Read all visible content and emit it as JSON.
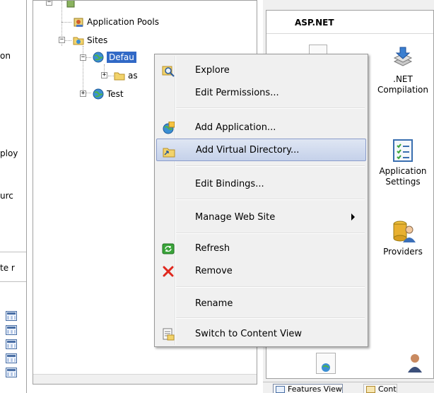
{
  "left_strip": {
    "fragments": [
      "on",
      "ploy",
      "urc",
      "te r"
    ]
  },
  "tree": {
    "top_item_partial": "...",
    "items": [
      {
        "label": "Application Pools",
        "icon": "app-pool-icon"
      },
      {
        "label": "Sites",
        "icon": "sites-folder-icon"
      },
      {
        "label": "Defau",
        "icon": "globe-icon",
        "selected": true
      },
      {
        "label": "as",
        "icon": "folder-icon"
      },
      {
        "label": "Test",
        "icon": "globe-icon"
      }
    ]
  },
  "features": {
    "group_title": "ASP.NET",
    "items": [
      {
        "label_line1": ".NET",
        "label_line2": "Compilation",
        "icon": "net-compilation-icon"
      },
      {
        "label_line1": "Application",
        "label_line2": "Settings",
        "icon": "app-settings-icon"
      },
      {
        "label_line1": "Providers",
        "label_line2": "",
        "icon": "providers-icon"
      }
    ]
  },
  "bottom_tabs": {
    "features_view": "Features View",
    "content_view": "Cont"
  },
  "context_menu": {
    "items": [
      {
        "label": "Explore",
        "icon": "explore-icon"
      },
      {
        "label": "Edit Permissions...",
        "icon": ""
      },
      {
        "label": "Add Application...",
        "icon": "add-application-icon"
      },
      {
        "label": "Add Virtual Directory...",
        "icon": "add-virtual-directory-icon",
        "highlighted": true
      },
      {
        "label": "Edit Bindings...",
        "icon": ""
      },
      {
        "label": "Manage Web Site",
        "icon": "",
        "submenu": true
      },
      {
        "label": "Refresh",
        "icon": "refresh-icon"
      },
      {
        "label": "Remove",
        "icon": "remove-icon"
      },
      {
        "label": "Rename",
        "icon": ""
      },
      {
        "label": "Switch to Content View",
        "icon": "content-view-icon"
      }
    ]
  },
  "colors": {
    "selection_blue": "#3169c6",
    "menu_highlight": "#c5d1ea",
    "remove_red": "#e0281e"
  }
}
